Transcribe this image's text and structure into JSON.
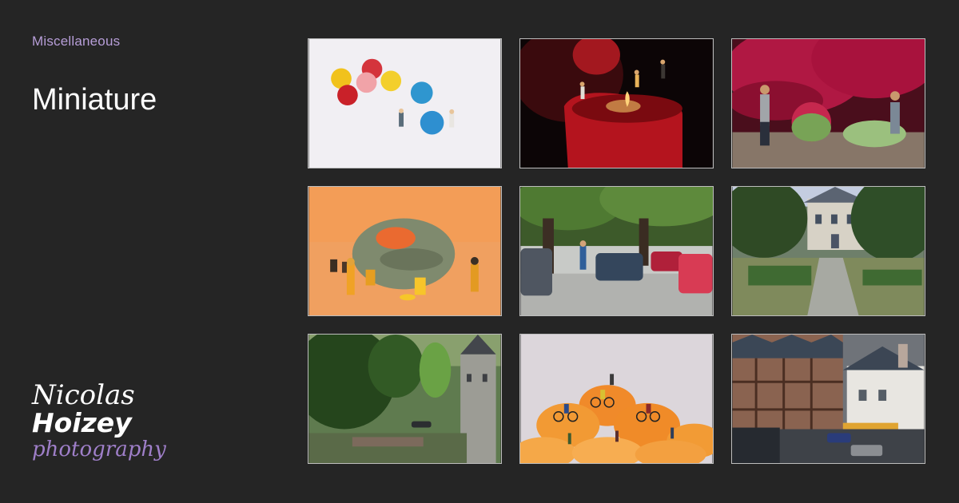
{
  "page": {
    "category": "Miscellaneous",
    "title": "Miniature"
  },
  "logo": {
    "line1": "Nicolas",
    "line2": "Hoizey",
    "line3": "photography"
  },
  "colors": {
    "background": "#252525",
    "accent": "#b79ed8",
    "logo_accent": "#9f7fc9",
    "tile_border": "#bdbdbd"
  },
  "gallery": [
    {
      "subject": "candy-figures-photo"
    },
    {
      "subject": "candle-figures-photo"
    },
    {
      "subject": "rose-gardeners-photo"
    },
    {
      "subject": "bread-hazmat-photo"
    },
    {
      "subject": "street-cars-tilt-shift-photo"
    },
    {
      "subject": "manor-garden-tilt-shift-photo"
    },
    {
      "subject": "castle-park-tilt-shift-photo"
    },
    {
      "subject": "orange-cyclists-photo"
    },
    {
      "subject": "timber-houses-tilt-shift-photo"
    }
  ]
}
